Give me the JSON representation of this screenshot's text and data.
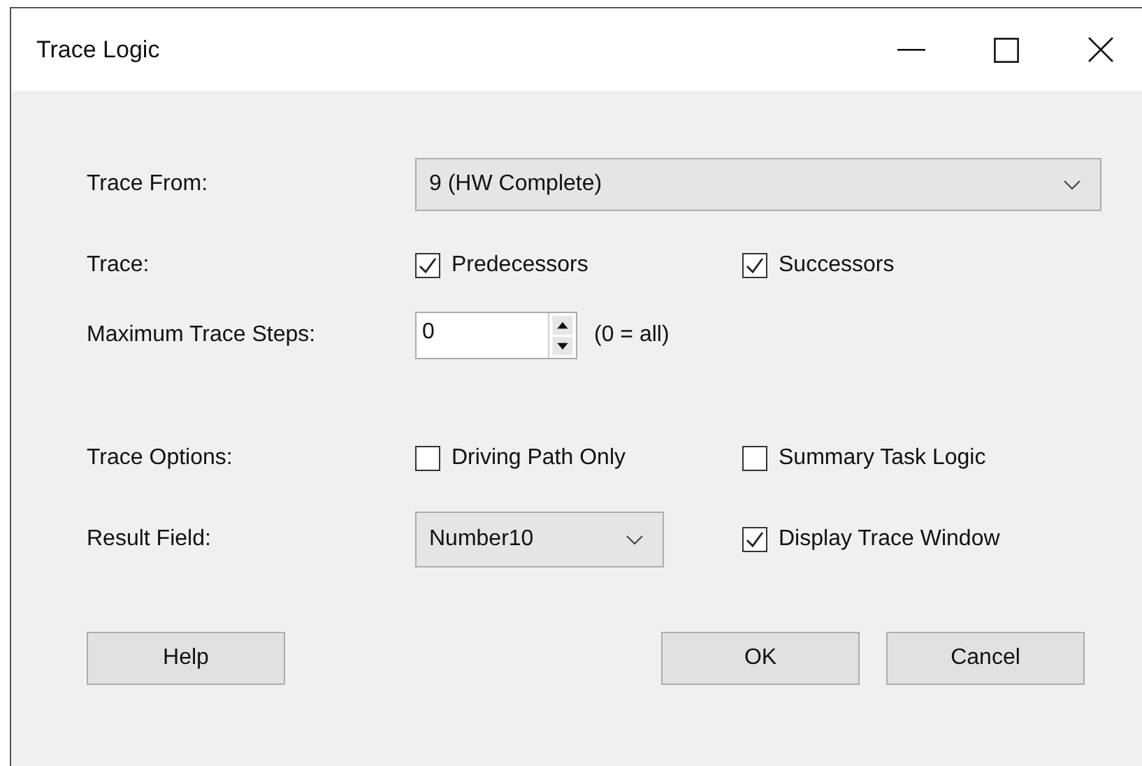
{
  "window": {
    "title": "Trace Logic"
  },
  "trace_from": {
    "label": "Trace From:",
    "value": "9 (HW Complete)"
  },
  "trace": {
    "label": "Trace:",
    "options": [
      {
        "label": "Predecessors",
        "checked": true
      },
      {
        "label": "Successors",
        "checked": true
      }
    ]
  },
  "max_trace_steps": {
    "label": "Maximum Trace Steps:",
    "value": "0",
    "hint": "(0 = all)"
  },
  "trace_options": {
    "label": "Trace Options:",
    "options": [
      {
        "label": "Driving Path Only",
        "checked": false
      },
      {
        "label": "Summary Task Logic",
        "checked": false
      }
    ]
  },
  "result_field": {
    "label": "Result Field:",
    "value": "Number10",
    "option": {
      "label": "Display Trace Window",
      "checked": true
    }
  },
  "buttons": {
    "help": "Help",
    "ok": "OK",
    "cancel": "Cancel"
  }
}
